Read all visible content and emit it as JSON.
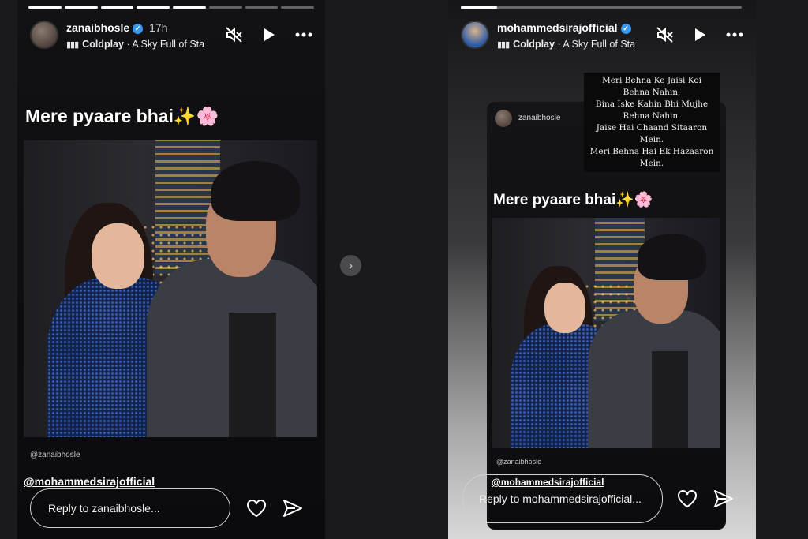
{
  "left_story": {
    "username": "zanaibhosle",
    "time": "17h",
    "music_artist": "Coldplay",
    "music_track": "A Sky Full of Sta",
    "caption_text": "Mere pyaare bhai",
    "caption_emoji_1": "✨",
    "caption_emoji_2": "🌸",
    "photo_tag": "@zanaibhosle",
    "mention": "@mohammedsirajofficial",
    "reply_placeholder": "Reply to zanaibhosle..."
  },
  "right_story": {
    "username": "mohammedsirajofficial",
    "music_artist": "Coldplay",
    "music_track": "A Sky Full of Sta",
    "reshared_username": "zanaibhosle",
    "caption_text": "Mere pyaare bhai",
    "caption_emoji_1": "✨",
    "caption_emoji_2": "🌸",
    "photo_tag": "@zanaibhosle",
    "mention": "@mohammedsirajofficial",
    "reply_placeholder": "Reply to mohammedsirajofficial...",
    "lyrics": [
      "Meri Behna Ke Jaisi Koi",
      "Behna Nahin,",
      "Bina Iske Kahin Bhi Mujhe",
      "Rehna Nahin.",
      "Jaise Hai Chaand Sitaaron",
      "Mein.",
      "Meri Behna Hai Ek Hazaaron",
      "Mein."
    ]
  },
  "colors": {
    "verified": "#3897f0",
    "background": "#1a1a1c"
  },
  "icons": [
    "mute-icon",
    "play-icon",
    "more-icon",
    "heart-icon",
    "send-icon",
    "chevron-right-icon",
    "music-bars-icon",
    "verified-icon"
  ]
}
